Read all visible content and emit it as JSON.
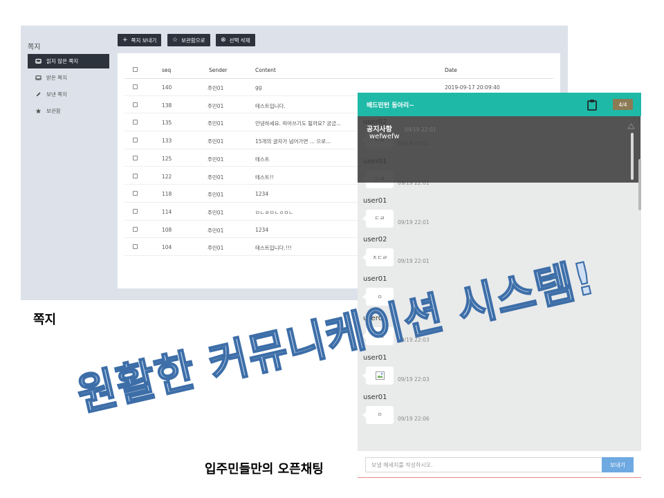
{
  "messages_app": {
    "title": "쪽지",
    "sidebar": [
      {
        "label": "읽지 않은 쪽지",
        "icon": "inbox-icon",
        "active": true
      },
      {
        "label": "받은 쪽지",
        "icon": "inbox-icon",
        "active": false
      },
      {
        "label": "보낸 쪽지",
        "icon": "pencil-icon",
        "active": false
      },
      {
        "label": "보관함",
        "icon": "star-icon",
        "active": false
      }
    ],
    "toolbar": {
      "send_icon": "+",
      "send_label": "쪽지 보내기",
      "archive_icon": "☆",
      "archive_label": "보관함으로",
      "delete_icon": "⊗",
      "delete_label": "선택 삭제"
    },
    "table": {
      "headers": {
        "seq": "seq",
        "sender": "Sender",
        "content": "Content",
        "date": "Date"
      },
      "rows": [
        {
          "seq": "140",
          "sender": "주민01",
          "content": "gg",
          "date": "2019-09-17 20:09:40"
        },
        {
          "seq": "138",
          "sender": "주민01",
          "content": "테스트입니다.",
          "date": ""
        },
        {
          "seq": "135",
          "sender": "주민01",
          "content": "안녕하세요. 띄어쓰기도 될까요? 궁금...",
          "date": ""
        },
        {
          "seq": "133",
          "sender": "주민01",
          "content": "15개의 글자가 넘어가면 ... 으로...",
          "date": ""
        },
        {
          "seq": "125",
          "sender": "주민01",
          "content": "테스트",
          "date": ""
        },
        {
          "seq": "122",
          "sender": "주민01",
          "content": "테스트!!",
          "date": ""
        },
        {
          "seq": "118",
          "sender": "주민01",
          "content": "1234",
          "date": ""
        },
        {
          "seq": "114",
          "sender": "주민01",
          "content": "ㅁㄴㄹㅁㄴㅇㅁㄴ",
          "date": ""
        },
        {
          "seq": "108",
          "sender": "주민01",
          "content": "1234",
          "date": ""
        },
        {
          "seq": "104",
          "sender": "주민01",
          "content": "테스트입니다.!!!",
          "date": ""
        }
      ]
    },
    "caption": "쪽지"
  },
  "chat": {
    "room_name": "배드민턴 동아리~",
    "member_count": "4/4",
    "header_icon": "clipboard-icon",
    "notice": {
      "title": "공지사항",
      "text": "wefwefw",
      "time": "09/19 22:01"
    },
    "messages": [
      {
        "user": "user02",
        "text": "ㄷㄹ",
        "time": "09/19 22:01"
      },
      {
        "user": "user01",
        "text": "ㄷㄹ",
        "time": "09/19 22:01"
      },
      {
        "user": "user01",
        "text": "ㄷㄹ",
        "time": "09/19 22:01"
      },
      {
        "user": "user02",
        "text": "ㅈㄷㄹ",
        "time": "09/19 22:01"
      },
      {
        "user": "user01",
        "text": "ㅇ",
        "time": ""
      },
      {
        "user": "user02",
        "text": "ㅊㅍ",
        "time": "09/19 22:03"
      },
      {
        "user": "user01",
        "text": "",
        "time": "09/19 22:03",
        "image": true
      },
      {
        "user": "user01",
        "text": "ㅇ",
        "time": "09/19 22:06"
      }
    ],
    "input_placeholder": "보낼 메세지를 작성하시오.",
    "send_label": "보내기",
    "caption": "입주민들만의 오픈채팅"
  },
  "headline": "원활한 커뮤니케이션 시스템!",
  "colors": {
    "accent": "#1fb9a8",
    "dark_button": "#2c333d",
    "send_button": "#6ea9e1",
    "headline_fill": "#cfe0f4",
    "headline_stroke": "#3d6ea8"
  }
}
